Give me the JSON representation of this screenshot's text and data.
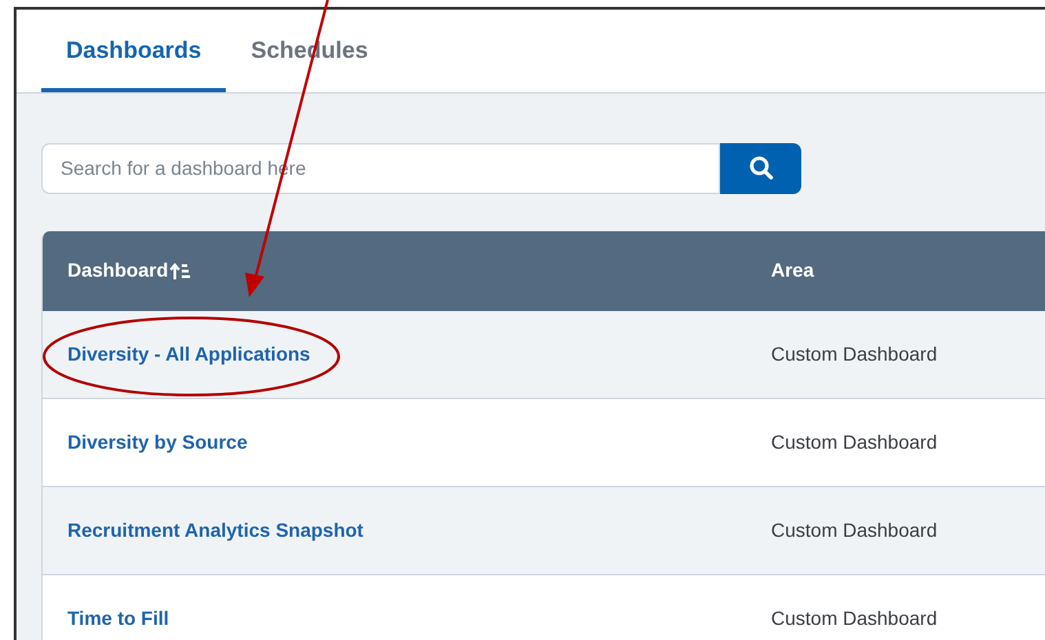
{
  "tabs": [
    {
      "label": "Dashboards",
      "selected": true
    },
    {
      "label": "Schedules",
      "selected": false
    }
  ],
  "search": {
    "placeholder": "Search for a dashboard here"
  },
  "table": {
    "columns": [
      "Dashboard",
      "Area"
    ],
    "rows": [
      {
        "name": "Diversity - All Applications",
        "area": "Custom Dashboard"
      },
      {
        "name": "Diversity by Source",
        "area": "Custom Dashboard"
      },
      {
        "name": "Recruitment Analytics Snapshot",
        "area": "Custom Dashboard"
      },
      {
        "name": "Time to Fill",
        "area": "Custom Dashboard"
      }
    ]
  }
}
